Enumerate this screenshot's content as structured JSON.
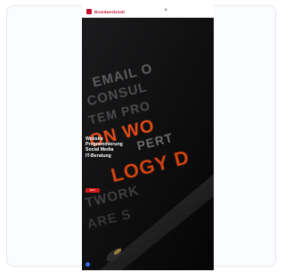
{
  "header": {
    "brand_name": "Brandwerkstatt",
    "menu_icon": "close-icon",
    "brand_color": "#c8102e"
  },
  "hero": {
    "tagline_lines": [
      "Website",
      "Programmierung",
      "Social Media",
      "IT-Beratung"
    ],
    "cta_label": "Mehr",
    "cta_color": "#d11a1a",
    "background_words": [
      "EMAIL O",
      "CONSUL",
      "TEM PRO",
      "ON WO",
      "PERT",
      "LOGY D",
      "TWORK",
      "ARE S"
    ]
  },
  "widget": {
    "icon": "chat-bubble-icon",
    "color": "#2d6ff0"
  }
}
